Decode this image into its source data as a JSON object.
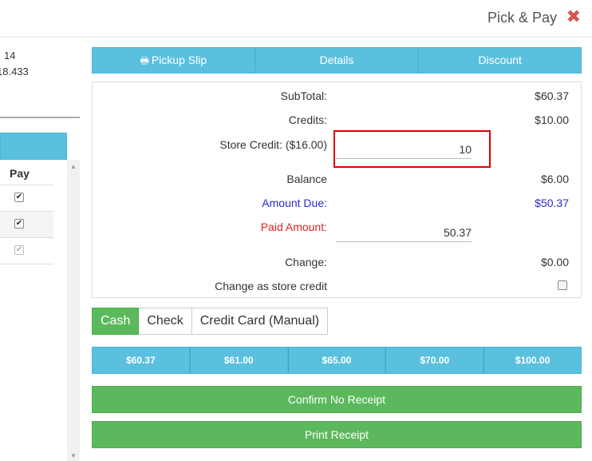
{
  "header": {
    "title": "Pick & Pay",
    "close_icon": "✖"
  },
  "left_panel": {
    "line1": "14",
    "line2": "18.433",
    "pay_header": "Pay",
    "checks": [
      "✔",
      "✔",
      "✔"
    ]
  },
  "tabs": {
    "pickup_slip": "Pickup Slip",
    "details": "Details",
    "discount": "Discount"
  },
  "summary": {
    "subtotal_label": "SubTotal:",
    "subtotal_value": "$60.37",
    "credits_label": "Credits:",
    "credits_value": "$10.00",
    "store_credit_label": "Store Credit: ($16.00)",
    "store_credit_input": "10",
    "balance_label": "Balance",
    "balance_value": "$6.00",
    "amount_due_label": "Amount Due:",
    "amount_due_value": "$50.37",
    "paid_amount_label": "Paid Amount:",
    "paid_amount_input": "50.37",
    "change_label": "Change:",
    "change_value": "$0.00",
    "change_store_credit_label": "Change as store credit"
  },
  "payment_methods": {
    "cash": "Cash",
    "check": "Check",
    "credit_card": "Credit Card (Manual)"
  },
  "quick_amounts": [
    "$60.37",
    "$61.00",
    "$65.00",
    "$70.00",
    "$100.00"
  ],
  "actions": {
    "confirm_no_receipt": "Confirm No Receipt",
    "print_receipt": "Print Receipt"
  },
  "colors": {
    "info_blue": "#5bc0de",
    "success_green": "#5cb85c",
    "amount_due_blue": "#2a2acc",
    "paid_red": "#e02020",
    "highlight_red": "#e00000"
  }
}
